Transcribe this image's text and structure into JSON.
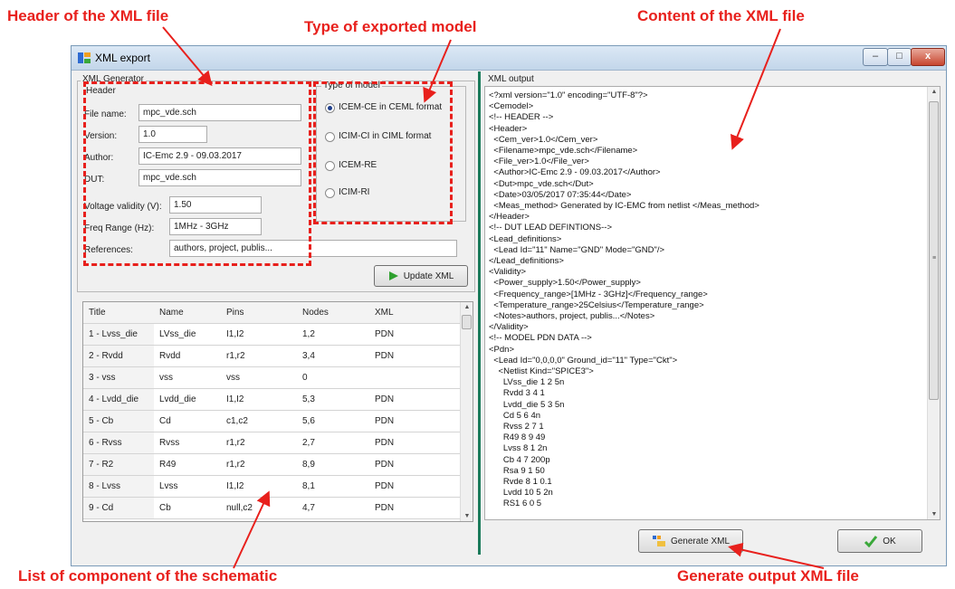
{
  "annotations": {
    "header": "Header of the XML file",
    "type": "Type of exported model",
    "content": "Content of the XML file",
    "list": "List of component of the schematic",
    "generate": "Generate output XML file"
  },
  "window": {
    "title": "XML export",
    "minimize": "–",
    "maximize": "□",
    "close": "x"
  },
  "generator": {
    "group_label": "XML Generator",
    "header_label": "Header",
    "file_name_label": "File name:",
    "file_name": "mpc_vde.sch",
    "version_label": "Version:",
    "version": "1.0",
    "author_label": "Author:",
    "author": "IC-Emc 2.9 - 09.03.2017",
    "dut_label": "DUT:",
    "dut": "mpc_vde.sch",
    "voltage_label": "Voltage validity (V):",
    "voltage": "1.50",
    "freq_label": "Freq Range (Hz):",
    "freq": "1MHz - 3GHz",
    "references_label": "References:",
    "references": "authors, project, publis...",
    "type_label": "Type of model",
    "model_options": [
      "ICEM-CE in CEML format",
      "ICIM-CI in CIML format",
      "ICEM-RE",
      "ICIM-RI"
    ],
    "selected_option": 0,
    "update_button": "Update XML"
  },
  "table": {
    "columns": [
      "Title",
      "Name",
      "Pins",
      "Nodes",
      "XML"
    ],
    "rows": [
      [
        "1 - Lvss_die",
        "LVss_die",
        "I1,I2",
        "1,2",
        "PDN"
      ],
      [
        "2 - Rvdd",
        "Rvdd",
        "r1,r2",
        "3,4",
        "PDN"
      ],
      [
        "3 - vss",
        "vss",
        "vss",
        "0",
        ""
      ],
      [
        "4 - Lvdd_die",
        "Lvdd_die",
        "I1,I2",
        "5,3",
        "PDN"
      ],
      [
        "5 - Cb",
        "Cd",
        "c1,c2",
        "5,6",
        "PDN"
      ],
      [
        "6 - Rvss",
        "Rvss",
        "r1,r2",
        "2,7",
        "PDN"
      ],
      [
        "7 - R2",
        "R49",
        "r1,r2",
        "8,9",
        "PDN"
      ],
      [
        "8 - Lvss",
        "Lvss",
        "I1,I2",
        "8,1",
        "PDN"
      ],
      [
        "9 - Cd",
        "Cb",
        "null,c2",
        "4,7",
        "PDN"
      ]
    ]
  },
  "xml_output": {
    "label": "XML output",
    "lines": [
      "<?xml version=\"1.0\" encoding=\"UTF-8\"?>",
      "<Cemodel>",
      "<!-- HEADER -->",
      "<Header>",
      "  <Cem_ver>1.0</Cem_ver>",
      "  <Filename>mpc_vde.sch</Filename>",
      "  <File_ver>1.0</File_ver>",
      "  <Author>IC-Emc 2.9 - 09.03.2017</Author>",
      "  <Dut>mpc_vde.sch</Dut>",
      "  <Date>03/05/2017 07:35:44</Date>",
      "  <Meas_method> Generated by IC-EMC from netlist </Meas_method>",
      "</Header>",
      "<!-- DUT LEAD DEFINTIONS-->",
      "<Lead_definitions>",
      "  <Lead Id=\"11\" Name=\"GND\" Mode=\"GND\"/>",
      "</Lead_definitions>",
      "<Validity>",
      "  <Power_supply>1.50</Power_supply>",
      "  <Frequency_range>[1MHz - 3GHz]</Frequency_range>",
      "  <Temperature_range>25Celsius</Temperature_range>",
      "  <Notes>authors, project, publis...</Notes>",
      "</Validity>",
      "<!-- MODEL PDN DATA -->",
      "<Pdn>",
      "  <Lead Id=\"0,0,0,0\" Ground_id=\"11\" Type=\"Ckt\">",
      "    <Netlist Kind=\"SPICE3\">",
      "      LVss_die 1 2 5n",
      "      Rvdd 3 4 1",
      "      Lvdd_die 5 3 5n",
      "      Cd 5 6 4n",
      "      Rvss 2 7 1",
      "      R49 8 9 49",
      "      Lvss 8 1 2n",
      "      Cb 4 7 200p",
      "      Rsa 9 1 50",
      "      Rvde 8 1 0.1",
      "      Lvdd 10 5 2n",
      "      RS1 6 0 5"
    ]
  },
  "footer": {
    "generate_button": "Generate XML",
    "ok_button": "OK"
  }
}
